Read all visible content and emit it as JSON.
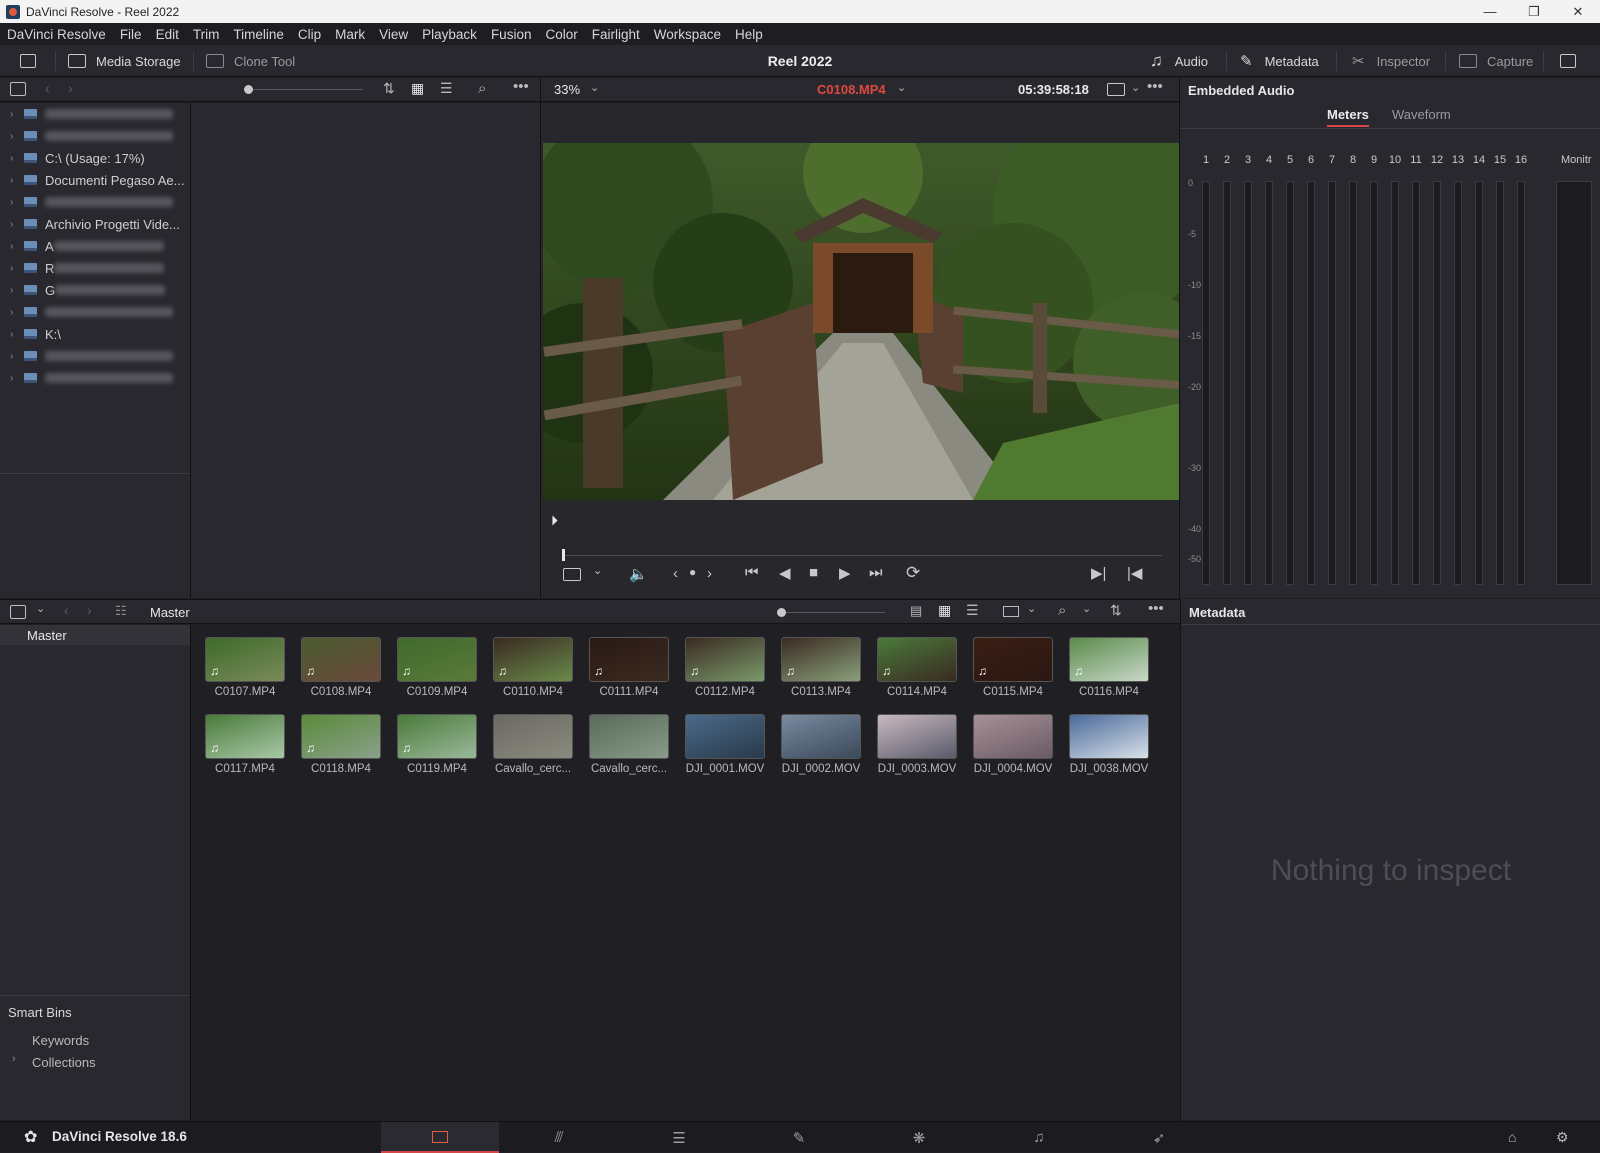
{
  "window": {
    "title": "DaVinci Resolve - Reel 2022",
    "controls": [
      "—",
      "❐",
      "✕"
    ]
  },
  "menu": [
    "DaVinci Resolve",
    "File",
    "Edit",
    "Trim",
    "Timeline",
    "Clip",
    "Mark",
    "View",
    "Playback",
    "Fusion",
    "Color",
    "Fairlight",
    "Workspace",
    "Help"
  ],
  "toolbar": {
    "media_storage": "Media Storage",
    "clone_tool": "Clone Tool",
    "project_title": "Reel 2022",
    "audio": "Audio",
    "metadata": "Metadata",
    "inspector": "Inspector",
    "capture": "Capture"
  },
  "storage": {
    "items": [
      {
        "label": "",
        "blurred": true
      },
      {
        "label": "",
        "blurred": true
      },
      {
        "label": "C:\\ (Usage: 17%)",
        "blurred": false
      },
      {
        "label": "Documenti Pegaso Ae...",
        "blurred": false
      },
      {
        "label": "",
        "blurred": true
      },
      {
        "label": "Archivio Progetti Vide...",
        "blurred": false
      },
      {
        "label": "A",
        "blurred": true
      },
      {
        "label": "R",
        "blurred": true
      },
      {
        "label": "G",
        "blurred": true
      },
      {
        "label": "",
        "blurred": true
      },
      {
        "label": "K:\\",
        "blurred": false
      },
      {
        "label": "",
        "blurred": true
      },
      {
        "label": "",
        "blurred": true
      }
    ]
  },
  "viewer": {
    "zoom": "33%",
    "clip_name": "C0108.MP4",
    "timecode": "05:39:58:18",
    "clip_color": "#e0493f"
  },
  "audio": {
    "title": "Embedded Audio",
    "tabs": [
      "Meters",
      "Waveform"
    ],
    "channels": [
      "1",
      "2",
      "3",
      "4",
      "5",
      "6",
      "7",
      "8",
      "9",
      "10",
      "11",
      "12",
      "13",
      "14",
      "15",
      "16"
    ],
    "monitor_label": "Monitr",
    "db_labels": [
      "0",
      "-5",
      "-10",
      "-15",
      "-20",
      "-30",
      "-40",
      "-50"
    ]
  },
  "pool": {
    "bin_title": "Master",
    "bins": [
      "Master"
    ],
    "smart_bins_title": "Smart Bins",
    "smart_bins": [
      "Keywords",
      "Collections"
    ],
    "clips_row1": [
      "C0107.MP4",
      "C0108.MP4",
      "C0109.MP4",
      "C0110.MP4",
      "C0111.MP4",
      "C0112.MP4",
      "C0113.MP4",
      "C0114.MP4",
      "C0115.MP4",
      "C0116.MP4"
    ],
    "clips_row2": [
      "C0117.MP4",
      "C0118.MP4",
      "C0119.MP4",
      "Cavallo_cerc...",
      "Cavallo_cerc...",
      "DJI_0001.MOV",
      "DJI_0002.MOV",
      "DJI_0003.MOV",
      "DJI_0004.MOV",
      "DJI_0038.MOV"
    ]
  },
  "metadata": {
    "title": "Metadata",
    "empty": "Nothing to inspect"
  },
  "footer": {
    "brand": "DaVinci Resolve 18.6",
    "accent": "#d5484a"
  }
}
